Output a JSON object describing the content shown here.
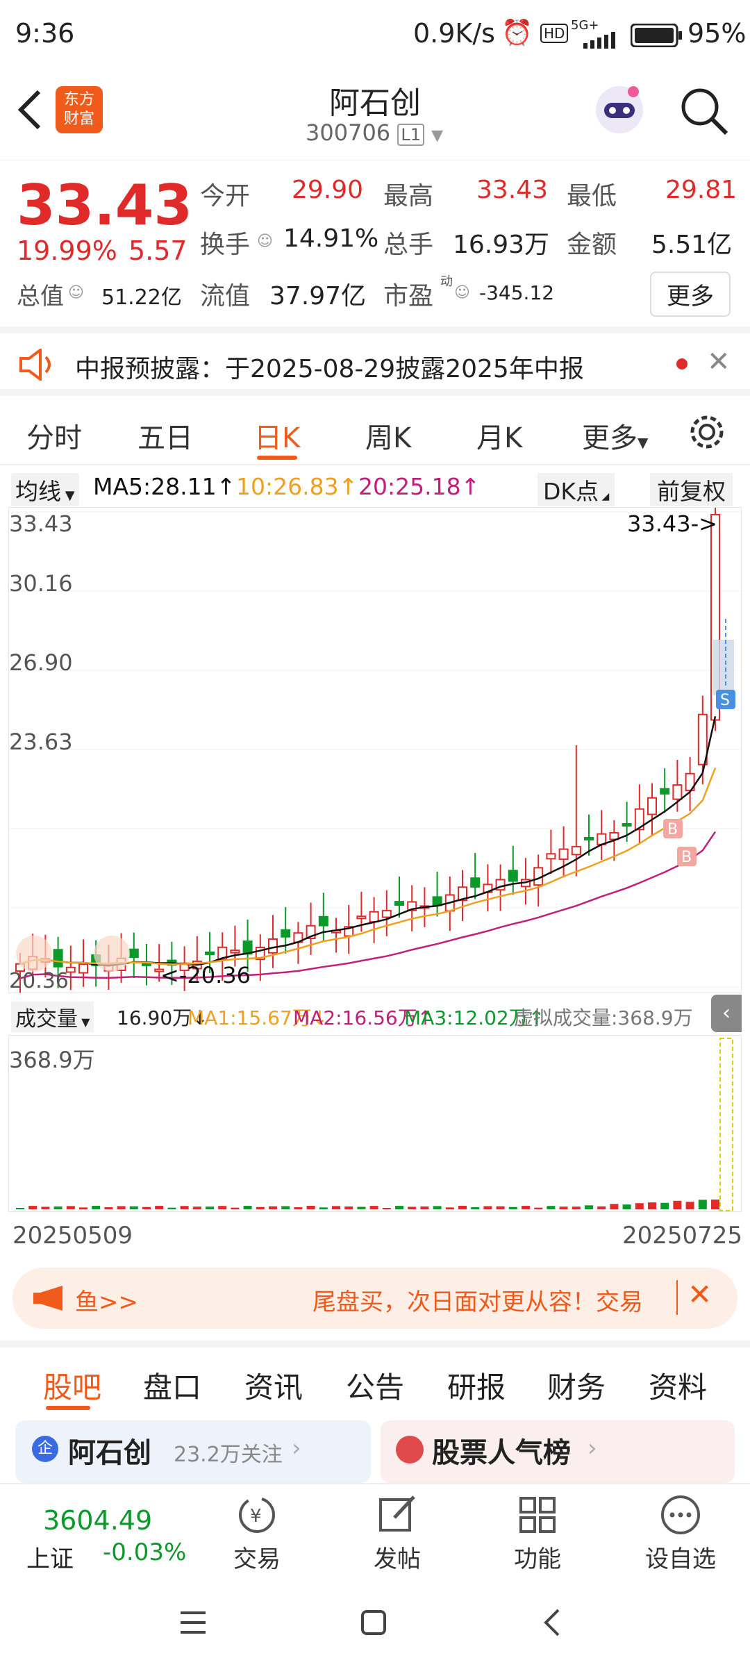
{
  "status": {
    "time": "9:36",
    "net": "0.9K/s",
    "battery": "95%",
    "signal": "5G+"
  },
  "header": {
    "logo_line1": "东方",
    "logo_line2": "财富",
    "title": "阿石创",
    "code": "300706",
    "level": "L1"
  },
  "quote": {
    "price": "33.43",
    "pct": "19.99%",
    "chg": "5.57",
    "open_label": "今开",
    "open": "29.90",
    "high_label": "最高",
    "high": "33.43",
    "low_label": "最低",
    "low": "29.81",
    "turnover_label": "换手",
    "turnover": "14.91%",
    "vol_label": "总手",
    "vol": "16.93万",
    "amount_label": "金额",
    "amount": "5.51亿",
    "mcap_label": "总值",
    "mcap": "51.22亿",
    "float_label": "流值",
    "float": "37.97亿",
    "pe_label": "市盈",
    "pe_sup": "动",
    "pe": "-345.12",
    "more": "更多"
  },
  "notice": {
    "text": "中报预披露：于2025-08-29披露2025年中报"
  },
  "tabs": [
    "分时",
    "五日",
    "日K",
    "周K",
    "月K",
    "更多"
  ],
  "ma": {
    "select": "均线",
    "ma5": "MA5:28.11",
    "ma10": "10:26.83",
    "ma20": "20:25.18",
    "dk": "DK点",
    "adjust": "前复权"
  },
  "chart": {
    "ticks": [
      "33.43",
      "30.16",
      "26.90",
      "23.63",
      "20.36"
    ],
    "max_marker": "33.43->",
    "min_marker": "<-20.36",
    "colors": {
      "up": "#e02a2a",
      "down": "#0a9a2a",
      "ma5": "#111111",
      "ma10": "#f0a020",
      "ma20": "#c0207a"
    }
  },
  "volume": {
    "select": "成交量",
    "cur": "16.90万",
    "ma1": "MA1:15.67万",
    "ma2": "MA2:16.56万",
    "ma3": "MA3:12.02万",
    "virtual": "虚拟成交量:368.9万",
    "max": "368.9万"
  },
  "dates": {
    "start": "20250509",
    "end": "20250725"
  },
  "banner": {
    "left": "鱼>>",
    "text": "尾盘买，次日面对更从容！交易"
  },
  "subtabs": [
    "股吧",
    "盘口",
    "资讯",
    "公告",
    "研报",
    "财务",
    "资料"
  ],
  "cards": {
    "left_name": "阿石创",
    "left_follow": "23.2万关注",
    "right_name": "股票人气榜"
  },
  "bottomnav": {
    "index_value": "3604.49",
    "index_name": "上证",
    "index_chg": "-0.03%",
    "items": [
      "交易",
      "发帖",
      "功能",
      "设自选"
    ]
  }
}
